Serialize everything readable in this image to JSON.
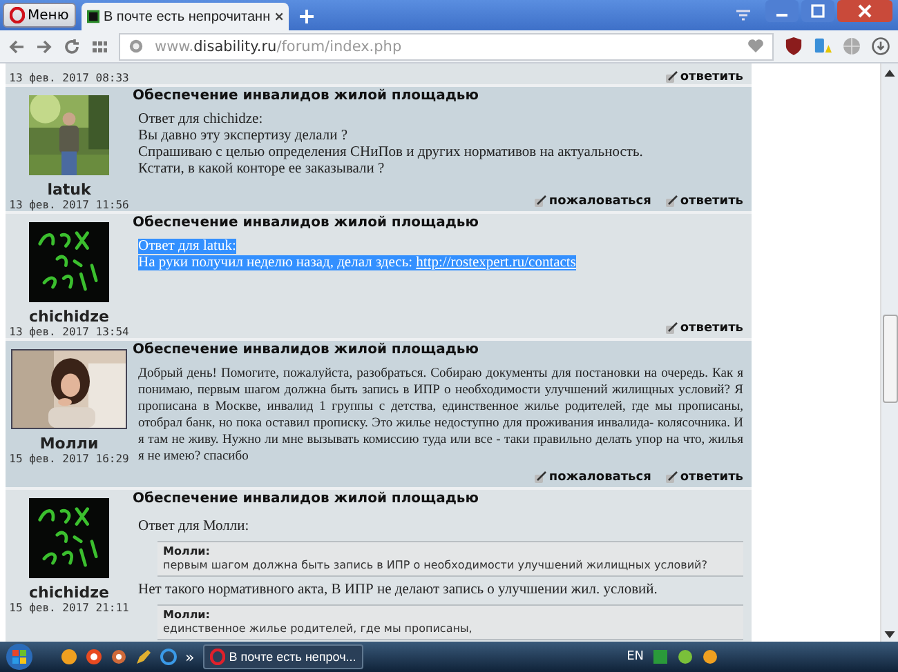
{
  "browser": {
    "menu_label": "Меню",
    "tabs": [
      {
        "title": "В почте есть непрочитанн",
        "selected": true
      }
    ],
    "url": {
      "prefix": "www.",
      "domain": "disability.ru",
      "path": "/forum/index.php"
    }
  },
  "posts": [
    {
      "partial": true,
      "shaded": false,
      "date": "13 фев. 2017 08:33",
      "actions": [
        "ответить"
      ]
    },
    {
      "shaded": true,
      "author": "latuk",
      "date": "13 фев. 2017 11:56",
      "title": "Обеспечение инвалидов жилой площадью",
      "body": [
        {
          "kind": "line",
          "text": "Ответ для chichidze:",
          "highlighted": false
        },
        {
          "kind": "line",
          "text": "Вы давно эту экспертизу делали ?",
          "highlighted": false
        },
        {
          "kind": "line",
          "text": "Спрашиваю с целью определения СНиПов и других нормативов на актуальность.",
          "highlighted": false
        },
        {
          "kind": "line",
          "text": "Кстати, в какой конторе ее заказывали ?",
          "highlighted": false
        }
      ],
      "actions": [
        "пожаловаться",
        "ответить"
      ]
    },
    {
      "shaded": false,
      "author": "chichidze",
      "date": "13 фев. 2017 13:54",
      "title": "Обеспечение инвалидов жилой площадью",
      "body": [
        {
          "kind": "line",
          "text": "Ответ для latuk:",
          "highlighted": true
        },
        {
          "kind": "line",
          "text": "На руки получил неделю назад, делал здесь: ",
          "link": "http://rostexpert.ru/contacts",
          "highlighted": true
        }
      ],
      "actions": [
        "ответить"
      ]
    },
    {
      "shaded": true,
      "author": "Молли",
      "date": "15 фев. 2017 16:29",
      "title": "Обеспечение инвалидов жилой площадью",
      "body": [
        {
          "kind": "paragraph",
          "text": "Добрый день! Помогите, пожалуйста, разобраться. Собираю документы для постановки на очередь. Как я понимаю, первым шагом должна быть запись в ИПР о необходимости улучшений жилищных условий? Я прописана в Москве, инвалид 1 группы с детства, единственное жилье родителей, где мы прописаны, отобрал банк, но пока оставил прописку. Это жилье недоступно для проживания инвалида- колясочника. И я там не живу. Нужно ли мне вызывать комиссию туда или все - таки правильно делать упор на что, жилья я не имею? спасибо",
          "highlighted": false
        }
      ],
      "actions": [
        "пожаловаться",
        "ответить"
      ]
    },
    {
      "shaded": false,
      "author": "chichidze",
      "date": "15 фев. 2017 21:11",
      "title": "Обеспечение инвалидов жилой площадью",
      "body": [
        {
          "kind": "line",
          "text": "Ответ для Молли:",
          "highlighted": false
        },
        {
          "kind": "quote",
          "author": "Молли:",
          "text": "первым шагом должна быть запись в ИПР о необходимости улучшений жилищных условий?"
        },
        {
          "kind": "line",
          "text": "Нет такого нормативного акта, В ИПР не делают запись о улучшении жил. условий.",
          "highlighted": false
        },
        {
          "kind": "quote",
          "author": "Молли:",
          "text": "единственное жилье родителей, где мы прописаны,"
        }
      ]
    }
  ],
  "taskbar": {
    "overflow": "»",
    "task": "В почте есть непроч...",
    "language": "EN"
  }
}
